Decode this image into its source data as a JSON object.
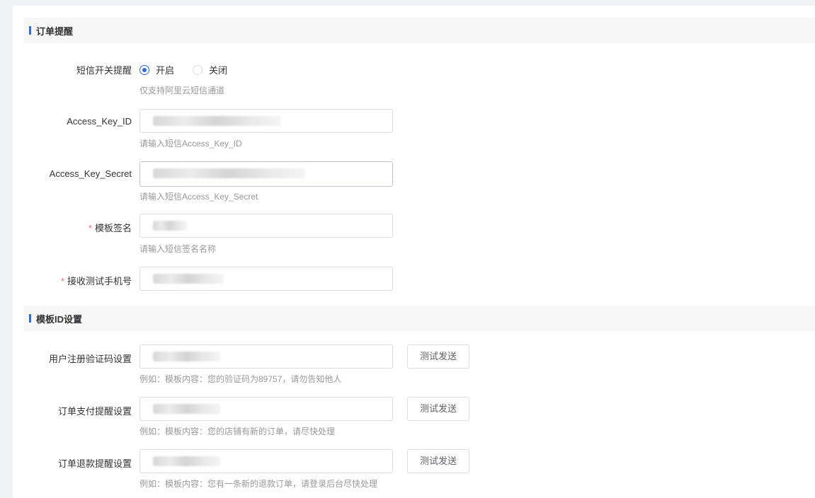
{
  "sections": {
    "order_reminder": {
      "title": "订单提醒"
    },
    "template_id": {
      "title": "模板ID设置"
    }
  },
  "sms_switch": {
    "label": "短信开关提醒",
    "options": [
      {
        "label": "开启",
        "checked": true
      },
      {
        "label": "关闭",
        "checked": false
      }
    ],
    "hint": "仅支持阿里云短信通道"
  },
  "access_key_id": {
    "label": "Access_Key_ID",
    "hint": "请输入短信Access_Key_ID"
  },
  "access_key_secret": {
    "label": "Access_Key_Secret",
    "hint": "请输入短信Access_Key_Secret"
  },
  "template_sign": {
    "required": "*",
    "label": "模板签名",
    "hint": "请输入短信签名名称"
  },
  "test_phone": {
    "required": "*",
    "label": "接收测试手机号"
  },
  "register_code": {
    "label": "用户注册验证码设置",
    "button": "测试发送",
    "hint": "例如：模板内容：您的验证码为89757，请勿告知他人"
  },
  "order_pay": {
    "label": "订单支付提醒设置",
    "button": "测试发送",
    "hint": "例如：模板内容：您的店铺有新的订单，请尽快处理"
  },
  "order_refund": {
    "label": "订单退款提醒设置",
    "button": "测试发送",
    "hint": "例如：模板内容：您有一条新的退款订单，请登录后台尽快处理"
  },
  "colors": {
    "accent": "#2d6ae8",
    "required": "#f56c6c",
    "section_bg": "#f7f7f7"
  }
}
